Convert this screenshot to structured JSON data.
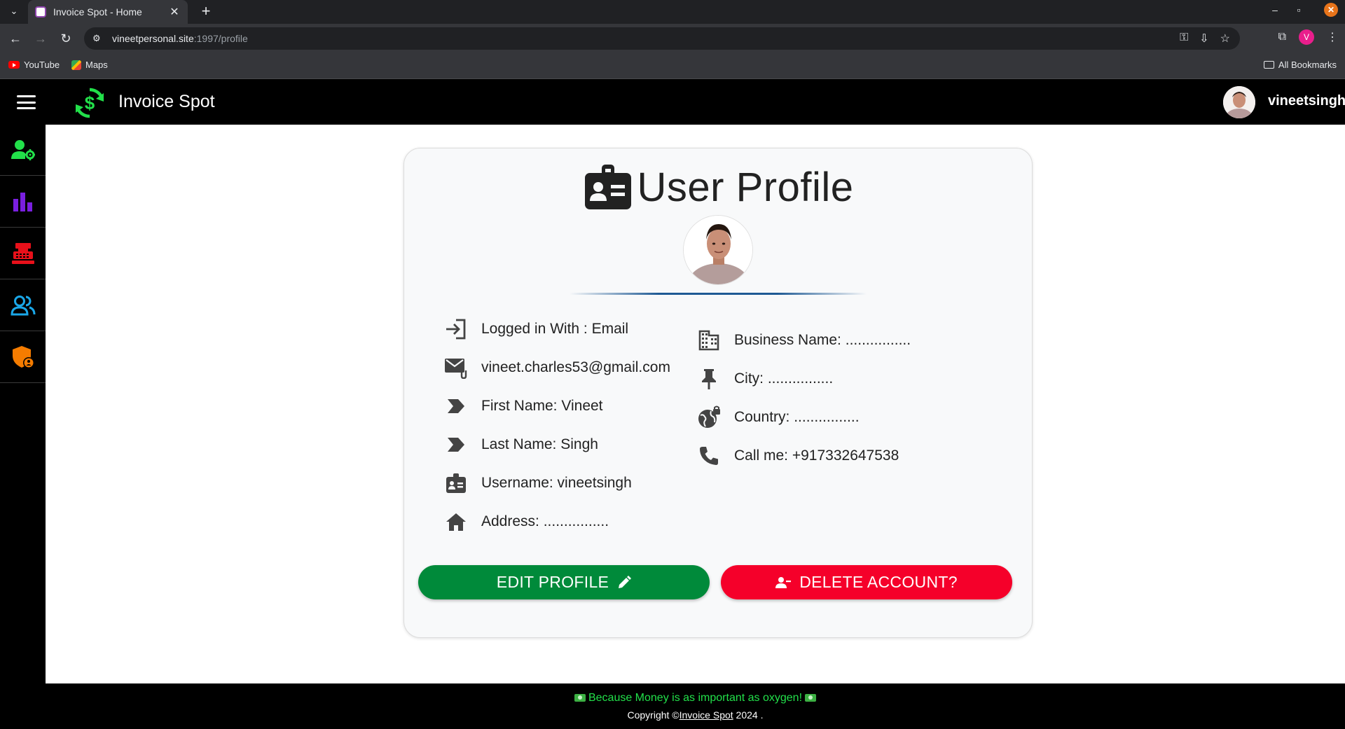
{
  "browser": {
    "tab_title": "Invoice Spot - Home",
    "url_host": "vineetpersonal.site",
    "url_path": ":1997/profile",
    "profile_initial": "V",
    "bookmarks": [
      {
        "label": "YouTube",
        "icon": "youtube-icon"
      },
      {
        "label": "Maps",
        "icon": "maps-icon"
      }
    ],
    "all_bookmarks": "All Bookmarks"
  },
  "appbar": {
    "brand": "Invoice Spot",
    "username": "vineetsingh"
  },
  "sidenav": {
    "items": [
      {
        "name": "user-settings",
        "icon": "user-gear-icon",
        "color": "#22e04a"
      },
      {
        "name": "analytics",
        "icon": "bar-chart-icon",
        "color": "#7a1fe0"
      },
      {
        "name": "cash-register",
        "icon": "cash-register-icon",
        "color": "#e8101a"
      },
      {
        "name": "users",
        "icon": "users-icon",
        "color": "#1aa7e8"
      },
      {
        "name": "security",
        "icon": "shield-user-icon",
        "color": "#f57c00"
      }
    ]
  },
  "profile": {
    "title": "User Profile",
    "left": [
      {
        "icon": "login-icon",
        "text": "Logged in With : Email"
      },
      {
        "icon": "email-icon",
        "text": "vineet.charles53@gmail.com"
      },
      {
        "icon": "label-icon",
        "text": "First Name: Vineet"
      },
      {
        "icon": "label-icon",
        "text": "Last Name: Singh"
      },
      {
        "icon": "badge-icon",
        "text": "Username: vineetsingh"
      },
      {
        "icon": "home-icon",
        "text": "Address: ................"
      }
    ],
    "right": [
      {
        "icon": "building-icon",
        "text": "Business Name: ................"
      },
      {
        "icon": "pin-icon",
        "text": "City: ................"
      },
      {
        "icon": "globe-icon",
        "text": "Country: ................"
      },
      {
        "icon": "phone-icon",
        "text": "Call me: +917332647538"
      }
    ],
    "edit_label": "EDIT PROFILE",
    "delete_label": "DELETE ACCOUNT?",
    "colors": {
      "edit": "#008a3a",
      "delete": "#f5002a",
      "brand": "#22e04a"
    }
  },
  "footer": {
    "tagline": "Because Money is as important as oxygen!",
    "copyright_prefix": "Copyright ©",
    "copyright_link": "Invoice Spot",
    "copyright_suffix": " 2024 ."
  }
}
